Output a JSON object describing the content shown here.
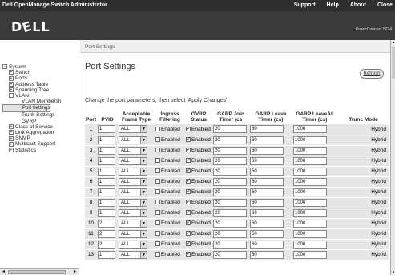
{
  "topbar": {
    "title": "Dell OpenManage Switch Administrator",
    "links": [
      "Support",
      "Help",
      "About",
      "Close"
    ]
  },
  "banner": {
    "logo": "DELL",
    "product": "PowerConnect 5224"
  },
  "tree": {
    "items": [
      {
        "label": "System",
        "toggle": "-",
        "level": 0
      },
      {
        "label": "Switch",
        "toggle": "+",
        "level": 1
      },
      {
        "label": "Ports",
        "toggle": "+",
        "level": 1
      },
      {
        "label": "Address Table",
        "toggle": "+",
        "level": 1
      },
      {
        "label": "Spanning Tree",
        "toggle": "+",
        "level": 1
      },
      {
        "label": "VLAN",
        "toggle": "-",
        "level": 1
      },
      {
        "label": "VLAN Membersh",
        "toggle": "",
        "level": 2
      },
      {
        "label": "Port Settings",
        "toggle": "",
        "level": 2,
        "selected": true
      },
      {
        "label": "Trunk Settings",
        "toggle": "",
        "level": 2
      },
      {
        "label": "GVRP",
        "toggle": "",
        "level": 2
      },
      {
        "label": "Class of Service",
        "toggle": "+",
        "level": 1
      },
      {
        "label": "Link Aggregation",
        "toggle": "+",
        "level": 1
      },
      {
        "label": "SNMP",
        "toggle": "+",
        "level": 1
      },
      {
        "label": "Multicast Support",
        "toggle": "+",
        "level": 1
      },
      {
        "label": "Statistics",
        "toggle": "+",
        "level": 1
      }
    ]
  },
  "main": {
    "breadcrumb": "Port Settings",
    "title": "Port Settings",
    "refresh_label": "Refresh",
    "instructions": "Change the port parameters, then select 'Apply Changes'"
  },
  "table": {
    "headers": {
      "port": "Port",
      "pvid": "PVID",
      "frame": "Acceptable Frame Type",
      "ingress": "Ingress Filtering",
      "gvrp": "GVRP Status",
      "join": "GARP Join Timer (cs",
      "leave": "GARP Leave Timer (cs)",
      "leaveall": "GARP LeaveAll Timer (cs)",
      "trunc": "Trunc Mode"
    },
    "enabled_label": "Enabled",
    "rows": [
      {
        "port": "1",
        "pvid": "1",
        "frame": "ALL",
        "ingress": false,
        "gvrp": true,
        "join": "20",
        "leave": "60",
        "leaveall": "1000",
        "mode": "Hybrid"
      },
      {
        "port": "2",
        "pvid": "1",
        "frame": "ALL",
        "ingress": false,
        "gvrp": true,
        "join": "20",
        "leave": "60",
        "leaveall": "1000",
        "mode": "Hybrid"
      },
      {
        "port": "3",
        "pvid": "1",
        "frame": "ALL",
        "ingress": false,
        "gvrp": true,
        "join": "20",
        "leave": "60",
        "leaveall": "1000",
        "mode": "Hybrid"
      },
      {
        "port": "4",
        "pvid": "1",
        "frame": "ALL",
        "ingress": false,
        "gvrp": true,
        "join": "20",
        "leave": "60",
        "leaveall": "1000",
        "mode": "Hybrid"
      },
      {
        "port": "5",
        "pvid": "1",
        "frame": "ALL",
        "ingress": false,
        "gvrp": true,
        "join": "20",
        "leave": "60",
        "leaveall": "1000",
        "mode": "Hybrid"
      },
      {
        "port": "6",
        "pvid": "1",
        "frame": "ALL",
        "ingress": false,
        "gvrp": true,
        "join": "20",
        "leave": "60",
        "leaveall": "1000",
        "mode": "Hybrid"
      },
      {
        "port": "7",
        "pvid": "1",
        "frame": "ALL",
        "ingress": false,
        "gvrp": true,
        "join": "20",
        "leave": "60",
        "leaveall": "1000",
        "mode": "Hybrid"
      },
      {
        "port": "8",
        "pvid": "1",
        "frame": "ALL",
        "ingress": false,
        "gvrp": true,
        "join": "20",
        "leave": "60",
        "leaveall": "1000",
        "mode": "Hybrid"
      },
      {
        "port": "9",
        "pvid": "1",
        "frame": "ALL",
        "ingress": false,
        "gvrp": true,
        "join": "20",
        "leave": "60",
        "leaveall": "1000",
        "mode": "Hybrid"
      },
      {
        "port": "10",
        "pvid": "2",
        "frame": "ALL",
        "ingress": false,
        "gvrp": true,
        "join": "20",
        "leave": "60",
        "leaveall": "1000",
        "mode": "Hybrid"
      },
      {
        "port": "11",
        "pvid": "2",
        "frame": "ALL",
        "ingress": false,
        "gvrp": true,
        "join": "20",
        "leave": "60",
        "leaveall": "1000",
        "mode": "Hybrid"
      },
      {
        "port": "12",
        "pvid": "2",
        "frame": "ALL",
        "ingress": false,
        "gvrp": true,
        "join": "20",
        "leave": "60",
        "leaveall": "1000",
        "mode": "Hybrid"
      },
      {
        "port": "13",
        "pvid": "1",
        "frame": "ALL",
        "ingress": false,
        "gvrp": true,
        "join": "20",
        "leave": "60",
        "leaveall": "1000",
        "mode": "Hybrid"
      }
    ]
  }
}
